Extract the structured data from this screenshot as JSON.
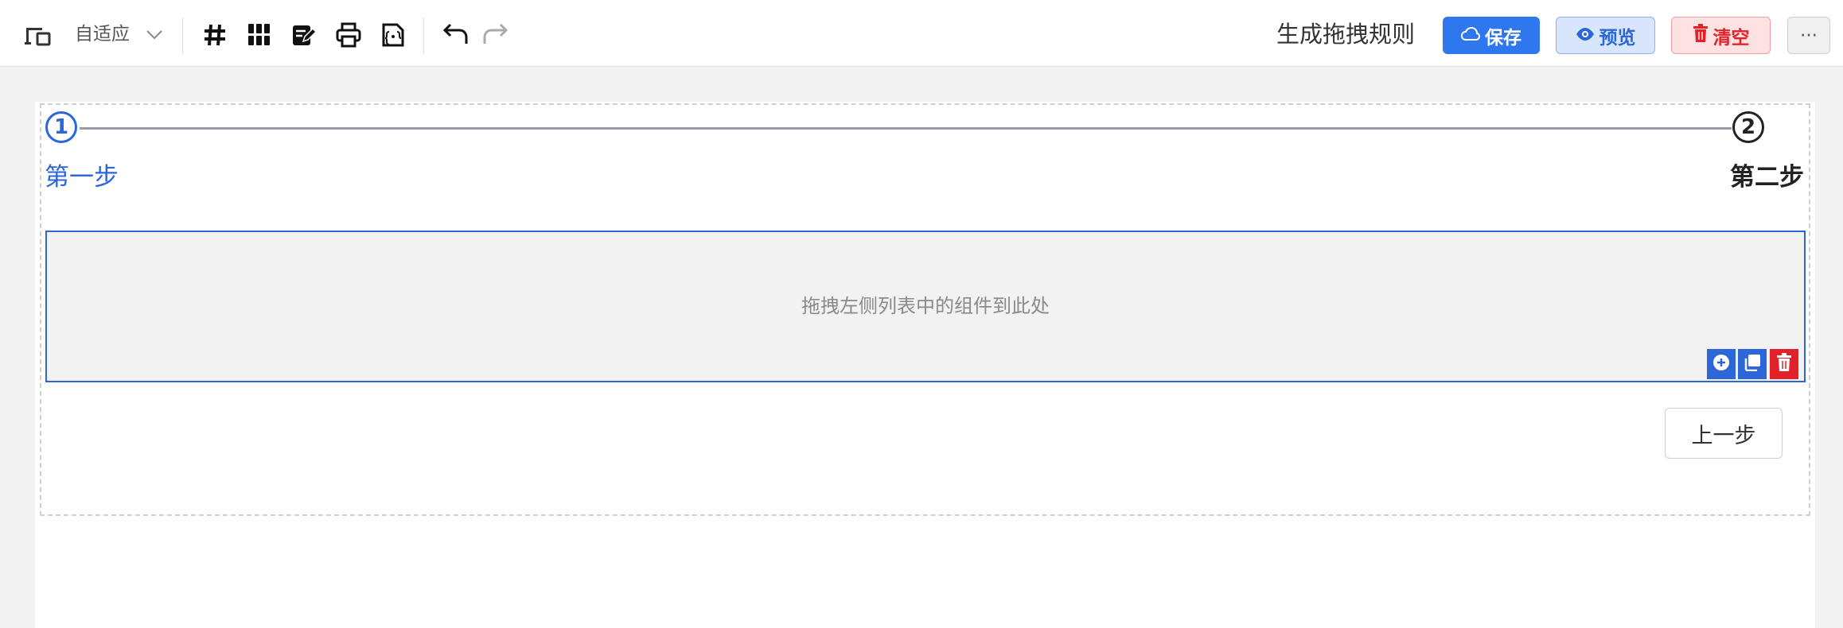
{
  "toolbar": {
    "device_mode_label": "自适应",
    "generate_rules_label": "生成拖拽规则",
    "save_label": "保存",
    "preview_label": "预览",
    "clear_label": "清空",
    "more_label": "···",
    "icons": [
      "device-icon",
      "chevron-down-icon",
      "grid-hash-icon",
      "layout-grid-icon",
      "edit-form-icon",
      "print-icon",
      "json-icon",
      "undo-icon",
      "redo-icon",
      "cloud-icon",
      "eye-icon",
      "trash-icon"
    ]
  },
  "steps": [
    {
      "number": "1",
      "label": "第一步",
      "active": true
    },
    {
      "number": "2",
      "label": "第二步",
      "active": false
    }
  ],
  "drop_zone": {
    "placeholder": "拖拽左侧列表中的组件到此处",
    "tools": [
      "plus-circle-icon",
      "copy-icon",
      "trash-icon"
    ]
  },
  "prev_button_label": "上一步",
  "colors": {
    "primary": "#2c66d9",
    "save_bg": "#2e77ee",
    "danger": "#e2212a",
    "canvas_bg": "#f2f2f2"
  }
}
